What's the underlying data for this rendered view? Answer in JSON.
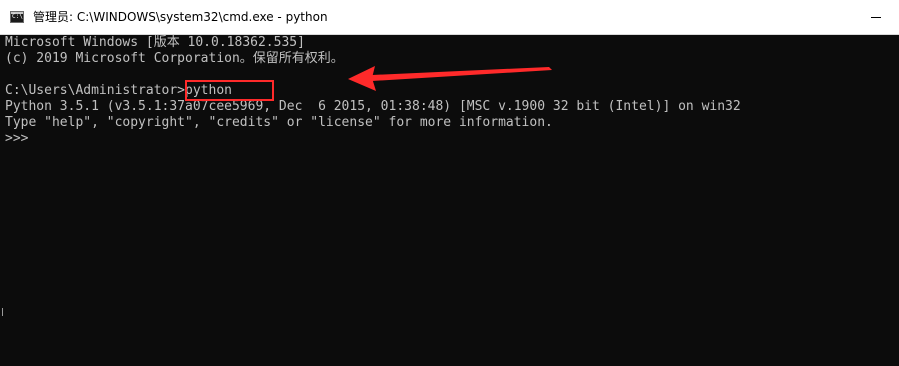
{
  "window": {
    "title": "管理员: C:\\WINDOWS\\system32\\cmd.exe - python",
    "icon": "cmd-icon",
    "icon_glyph": "C:\\",
    "minimize_glyph": "minimize-icon"
  },
  "console": {
    "lines": [
      "Microsoft Windows [版本 10.0.18362.535]",
      "(c) 2019 Microsoft Corporation。保留所有权利。",
      "",
      "C:\\Users\\Administrator>python",
      "Python 3.5.1 (v3.5.1:37a07cee5969, Dec  6 2015, 01:38:48) [MSC v.1900 32 bit (Intel)] on win32",
      "Type \"help\", \"copyright\", \"credits\" or \"license\" for more information.",
      ">>>"
    ],
    "prompt": "C:\\Users\\Administrator>",
    "command": "python"
  },
  "annotation": {
    "color": "#ff2a2a"
  },
  "colors": {
    "console_bg": "#0c0c0c",
    "console_text": "#c0c0c0",
    "titlebar_bg": "#ffffff"
  }
}
